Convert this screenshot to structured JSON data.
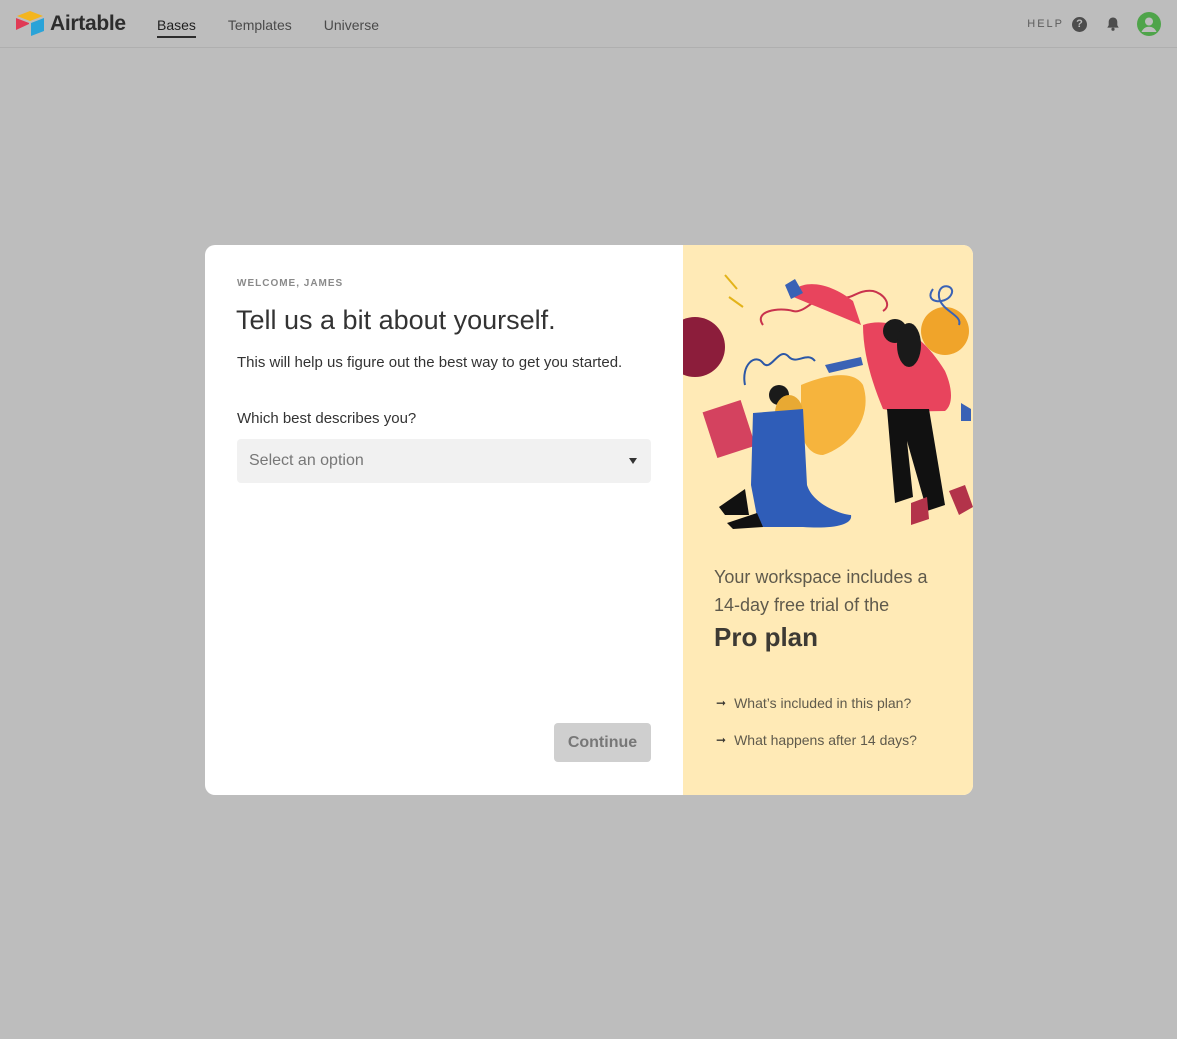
{
  "topbar": {
    "brand": "Airtable",
    "tabs": [
      {
        "label": "Bases",
        "active": true
      },
      {
        "label": "Templates",
        "active": false
      },
      {
        "label": "Universe",
        "active": false
      }
    ],
    "help_label": "HELP",
    "icons": [
      "help-icon",
      "bell-icon",
      "avatar-icon"
    ]
  },
  "onboarding": {
    "eyebrow": "WELCOME, JAMES",
    "title": "Tell us a bit about yourself.",
    "subtitle": "This will help us figure out the best way to get you started.",
    "question_label": "Which best describes you?",
    "select_placeholder": "Select an option",
    "continue_label": "Continue"
  },
  "promo": {
    "lead": "Your workspace includes a 14-day free trial of the",
    "plan_name": "Pro plan",
    "links": [
      {
        "label": "What’s included in this plan?"
      },
      {
        "label": "What happens after 14 days?"
      }
    ]
  },
  "colors": {
    "backdrop": "#bdbdbd",
    "promo_bg": "#ffeab6",
    "avatar": "#4fa44a",
    "continue_disabled": "#cfcfcf"
  }
}
